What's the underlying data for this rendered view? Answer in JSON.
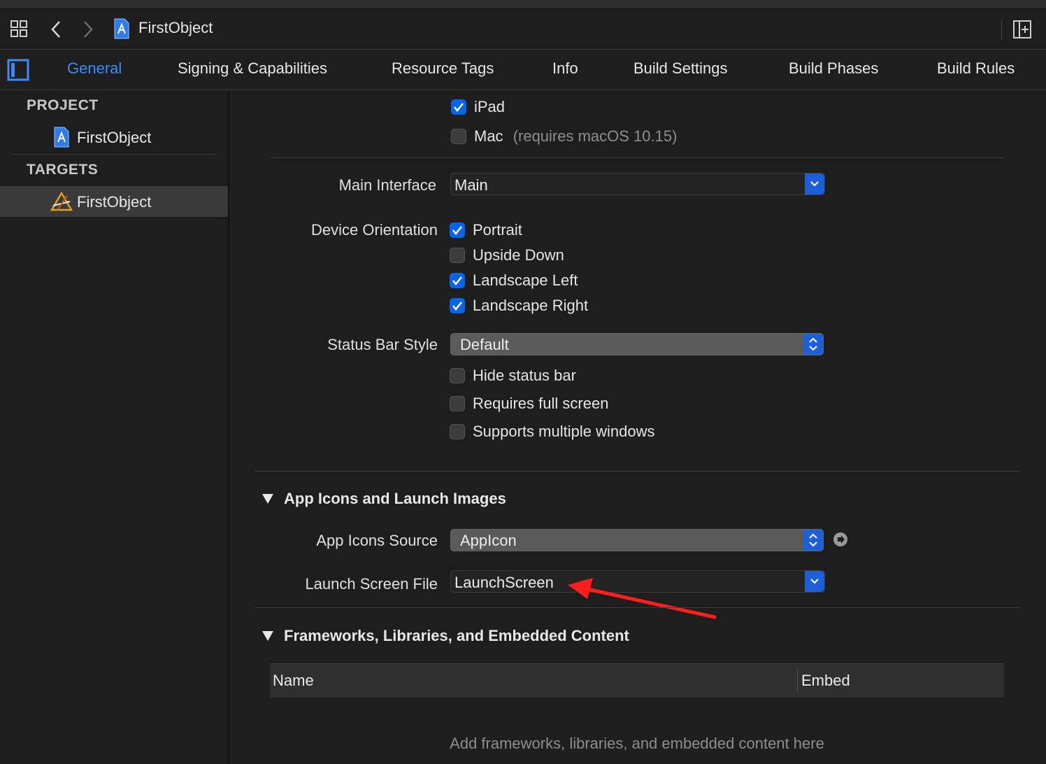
{
  "toolbar": {
    "title": "FirstObject"
  },
  "tabs": [
    {
      "label": "General",
      "active": true
    },
    {
      "label": "Signing & Capabilities"
    },
    {
      "label": "Resource Tags"
    },
    {
      "label": "Info"
    },
    {
      "label": "Build Settings"
    },
    {
      "label": "Build Phases"
    },
    {
      "label": "Build Rules"
    }
  ],
  "sidebar": {
    "project_header": "PROJECT",
    "project_item": "FirstObject",
    "targets_header": "TARGETS",
    "target_item": "FirstObject"
  },
  "devices": {
    "ipad": {
      "label": "iPad",
      "checked": true
    },
    "mac": {
      "label": "Mac",
      "hint": "(requires macOS 10.15)",
      "checked": false
    }
  },
  "main_interface": {
    "label": "Main Interface",
    "value": "Main"
  },
  "device_orientation": {
    "label": "Device Orientation",
    "options": [
      {
        "label": "Portrait",
        "checked": true
      },
      {
        "label": "Upside Down",
        "checked": false
      },
      {
        "label": "Landscape Left",
        "checked": true
      },
      {
        "label": "Landscape Right",
        "checked": true
      }
    ]
  },
  "status_bar": {
    "label": "Status Bar Style",
    "value": "Default",
    "options": [
      {
        "label": "Hide status bar",
        "checked": false
      },
      {
        "label": "Requires full screen",
        "checked": false
      },
      {
        "label": "Supports multiple windows",
        "checked": false
      }
    ]
  },
  "app_icons_section": {
    "title": "App Icons and Launch Images",
    "icons_source_label": "App Icons Source",
    "icons_source_value": "AppIcon",
    "launch_screen_label": "Launch Screen File",
    "launch_screen_value": "LaunchScreen"
  },
  "frameworks_section": {
    "title": "Frameworks, Libraries, and Embedded Content",
    "columns": [
      "Name",
      "Embed"
    ],
    "empty_message": "Add frameworks, libraries, and embedded content here"
  },
  "colors": {
    "accent": "#3c8cf6",
    "checkbox_on": "#0a64e8",
    "annotation_arrow": "#ff1e1e"
  },
  "icons": [
    "related-items-icon",
    "back-icon",
    "forward-icon",
    "project-file-icon",
    "add-editor-icon",
    "sidebar-toggle-icon",
    "app-target-icon",
    "chevron-down-icon",
    "up-down-icon",
    "go-arrow-icon",
    "disclosure-triangle-icon"
  ]
}
